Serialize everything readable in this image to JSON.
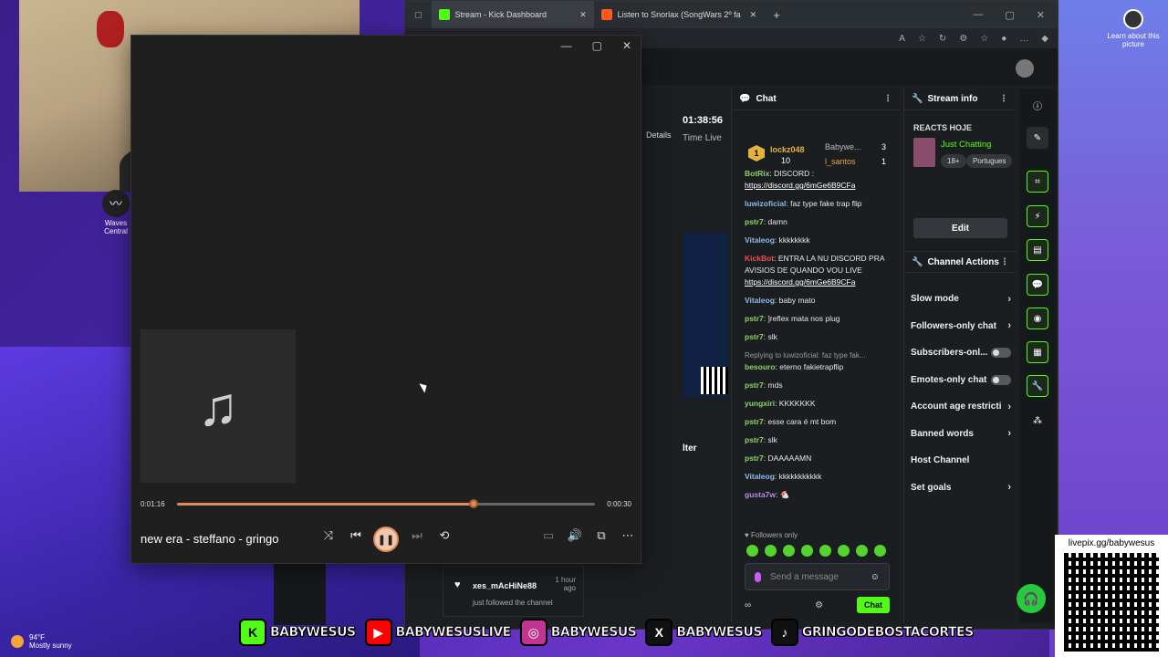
{
  "desktop": {
    "icon_label": "Waves Central",
    "learn_label": "Learn about this picture"
  },
  "browser": {
    "tabs": [
      {
        "label": "Stream - Kick Dashboard"
      },
      {
        "label": "Listen to Snorlax (SongWars 2º fa"
      }
    ]
  },
  "dashboard": {
    "uptime": "01:38:56",
    "time_live_label": "Time Live",
    "details_label": "Details",
    "side_label": "lter",
    "chat": {
      "title": "Chat",
      "leaderboard": {
        "rank": "1",
        "top_user": "lockz048",
        "top_count": "10",
        "second_user": "Babywe...",
        "second_count": "3",
        "third_user": "l_santos",
        "third_count": "1"
      },
      "messages": [
        {
          "user": "BotRix",
          "text": "DISCORD :",
          "link": "https://discord.gg/6mGe6B9CFa",
          "color": "green"
        },
        {
          "user": "luwizoficial",
          "text": "faz type fake trap flip",
          "color": "blue"
        },
        {
          "user": "pstr7",
          "text": "damn",
          "color": "green"
        },
        {
          "user": "Vitaleog",
          "text": "kkkkkkkk",
          "color": "blue"
        },
        {
          "user": "KickBot",
          "text": "ENTRA LA NU DISCORD PRA AVISIOS DE QUANDO VOU LIVE",
          "link": "https://discord.gg/6mGe6B9CFa",
          "color": "red"
        },
        {
          "user": "Vitaleog",
          "text": "baby mato",
          "color": "blue"
        },
        {
          "user": "pstr7",
          "text": "]reflex mata nos plug",
          "color": "green"
        },
        {
          "user": "pstr7",
          "text": "slk",
          "color": "green"
        },
        {
          "reply": "Replying to luwizoficial: faz type fak...",
          "user": "besouro",
          "text": "eterno fakietrapflip",
          "color": "green"
        },
        {
          "user": "pstr7",
          "text": "mds",
          "color": "green"
        },
        {
          "user": "yungxiri",
          "text": "KKKKKKK",
          "color": "green"
        },
        {
          "user": "pstr7",
          "text": "esse cara é mt bom",
          "color": "green"
        },
        {
          "user": "pstr7",
          "text": "slk",
          "color": "green"
        },
        {
          "user": "pstr7",
          "text": "DAAAAAMN",
          "color": "green"
        },
        {
          "user": "Vitaleog",
          "text": "kkkkkkkkkkk",
          "color": "blue"
        },
        {
          "user": "gusta7w",
          "text": "",
          "color": "purple"
        }
      ],
      "followers_only": "Followers only",
      "input_placeholder": "Send a message",
      "chat_button": "Chat"
    },
    "stream_info": {
      "title": "Stream info",
      "stream_title": "REACTS HOJE",
      "category": "Just Chatting",
      "tags": [
        "18+",
        "Portugues"
      ],
      "edit_label": "Edit"
    },
    "channel_actions": {
      "title": "Channel Actions",
      "items": [
        {
          "label": "Slow mode",
          "kind": "chevron"
        },
        {
          "label": "Followers-only chat",
          "kind": "chevron"
        },
        {
          "label": "Subscribers-onl...",
          "kind": "toggle"
        },
        {
          "label": "Emotes-only chat",
          "kind": "toggle"
        },
        {
          "label": "Account age restricti",
          "kind": "chevron"
        },
        {
          "label": "Banned words",
          "kind": "chevron"
        },
        {
          "label": "Host Channel",
          "kind": "none"
        },
        {
          "label": "Set goals",
          "kind": "chevron"
        }
      ]
    },
    "follow_event": {
      "name": "xes_mAcHiNe88",
      "time": "1 hour ago",
      "action": "just followed the channel"
    }
  },
  "player": {
    "current_time": "0:01:16",
    "total_time": "0:00:30",
    "progress": 0.71,
    "song": "new era - steffano - gringo",
    "accent": "#e08a55"
  },
  "taskbar": {
    "temperature": "94°F",
    "weather": "Mostly sunny"
  },
  "socials": [
    {
      "platform": "kick",
      "handle": "BABYWESUS",
      "color": "#53fc18"
    },
    {
      "platform": "youtube",
      "handle": "BABYWESUSLIVE",
      "color": "#ff0000"
    },
    {
      "platform": "instagram",
      "handle": "BABYWESUS",
      "color": "#c1358f"
    },
    {
      "platform": "x",
      "handle": "BABYWESUS",
      "color": "#000000"
    },
    {
      "platform": "tiktok",
      "handle": "GRINGODEBOSTACORTES",
      "color": "#000000"
    }
  ],
  "qr": {
    "label": "livepix.gg/babywesus"
  }
}
